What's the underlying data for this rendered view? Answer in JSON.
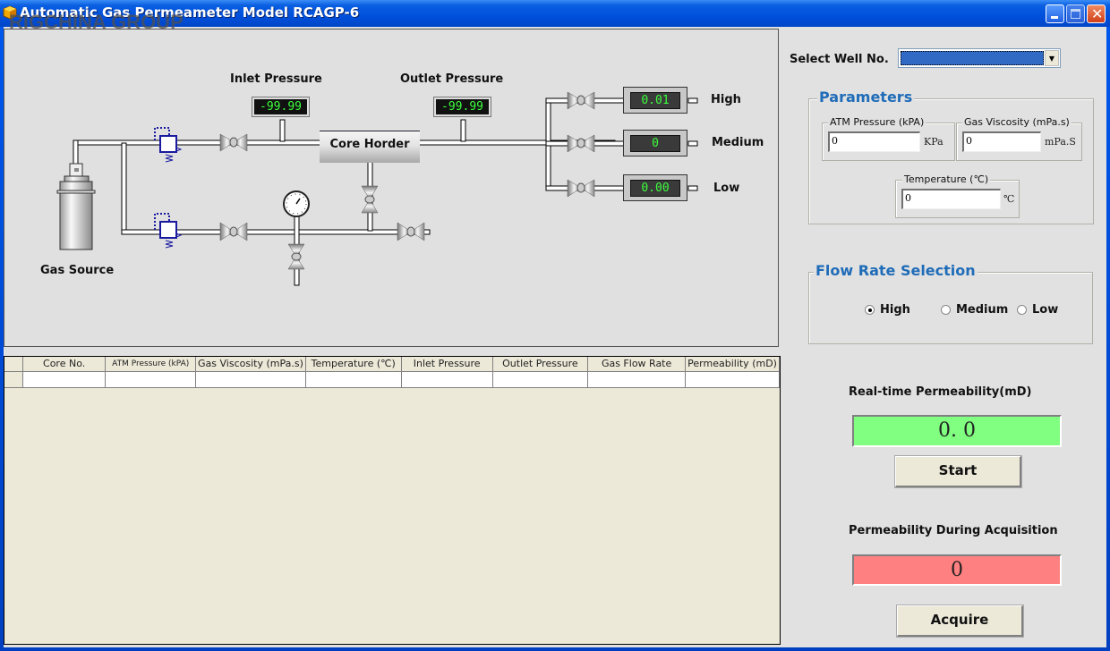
{
  "window": {
    "title": "Automatic Gas Permeameter Model RCAGP-6",
    "watermark": "RIGCHINA GROUP",
    "controls": [
      "minimize",
      "maximize",
      "close"
    ]
  },
  "diagram": {
    "labels": {
      "inlet_pressure": "Inlet Pressure",
      "outlet_pressure": "Outlet Pressure",
      "core_holder": "Core Horder",
      "gas_source": "Gas Source"
    },
    "inlet_pressure_value": "-99.99",
    "outlet_pressure_value": "-99.99",
    "flowmeters": [
      {
        "label": "High",
        "value": "0.01"
      },
      {
        "label": "Medium",
        "value": "0"
      },
      {
        "label": "Low",
        "value": "0.00"
      }
    ]
  },
  "table": {
    "columns": [
      "Core No.",
      "ATM Pressure (kPA)",
      "Gas Viscosity (mPa.s)",
      "Temperature (℃)",
      "Inlet Pressure",
      "Outlet Pressure",
      "Gas Flow Rate",
      "Permeability (mD)"
    ],
    "rows": [
      [
        "",
        "",
        "",
        "",
        "",
        "",
        "",
        ""
      ]
    ]
  },
  "right": {
    "select_well_label": "Select Well No.",
    "select_well_value": "",
    "parameters": {
      "title": "Parameters",
      "atm_pressure": {
        "label": "ATM Pressure (kPA)",
        "value": "0",
        "unit": "KPa"
      },
      "gas_viscosity": {
        "label": "Gas Viscosity (mPa.s)",
        "value": "0",
        "unit": "mPa.S"
      },
      "temperature": {
        "label": "Temperature (℃)",
        "value": "0",
        "unit": "℃"
      }
    },
    "flow_rate": {
      "title": "Flow Rate Selection",
      "options": [
        "High",
        "Medium",
        "Low"
      ],
      "selected": "High"
    },
    "realtime": {
      "label": "Real-time Permeability(mD)",
      "value": "0. 0",
      "color": "#80ff80",
      "button": "Start"
    },
    "acquisition": {
      "label": "Permeability During Acquisition",
      "value": "0",
      "color": "#ff8080",
      "button": "Acquire"
    }
  }
}
